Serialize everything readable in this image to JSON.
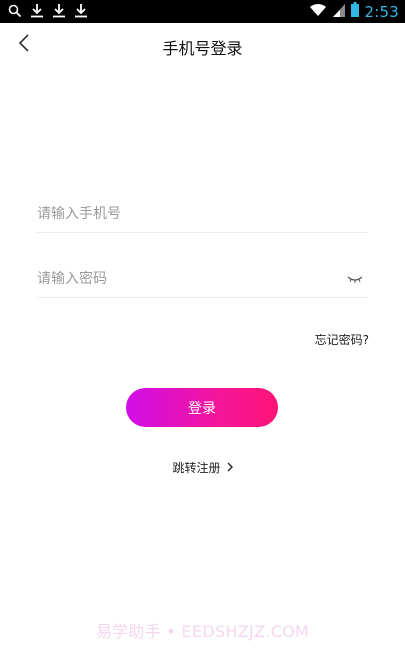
{
  "status_bar": {
    "time": "2:53",
    "icons": [
      "search-icon",
      "download-icon",
      "download-icon",
      "download-icon",
      "wifi-icon",
      "signal-icon",
      "battery-icon"
    ]
  },
  "header": {
    "title": "手机号登录",
    "back_icon": "chevron-left-icon"
  },
  "form": {
    "phone_placeholder": "请输入手机号",
    "phone_value": "",
    "password_placeholder": "请输入密码",
    "password_value": "",
    "eye_icon": "eye-closed-icon"
  },
  "forgot_password": "忘记密码?",
  "login_button": "登录",
  "register_link": "跳转注册",
  "watermark": "易学助手 • EEDSHZJZ.COM",
  "colors": {
    "gradient_start": "#d00ee8",
    "gradient_end": "#ff1475",
    "time_color": "#33b5e5"
  }
}
